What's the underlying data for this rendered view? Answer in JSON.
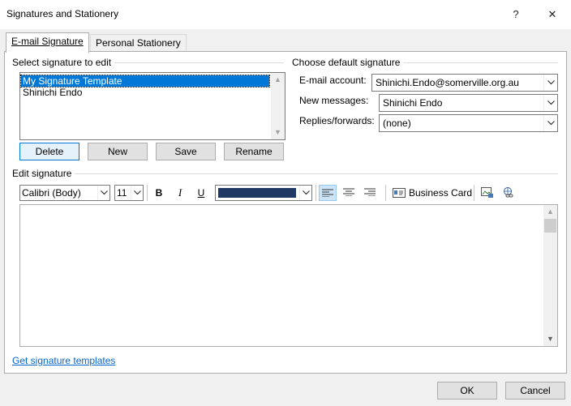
{
  "window": {
    "title": "Signatures and Stationery",
    "help_glyph": "?",
    "close_glyph": "✕"
  },
  "tabs": [
    {
      "label": "E-mail Signature",
      "active": true
    },
    {
      "label": "Personal Stationery",
      "active": false
    }
  ],
  "select_section": {
    "label": "Select signature to edit",
    "items": [
      {
        "label": "My Signature Template",
        "selected": true
      },
      {
        "label": "Shinichi Endo",
        "selected": false
      }
    ],
    "buttons": {
      "delete": "Delete",
      "new": "New",
      "save": "Save",
      "rename": "Rename"
    }
  },
  "default_section": {
    "label": "Choose default signature",
    "email_account": {
      "label": "E-mail account:",
      "value": "Shinichi.Endo@somerville.org.au"
    },
    "new_messages": {
      "label": "New messages:",
      "value": "Shinichi Endo"
    },
    "replies_forwards": {
      "label": "Replies/forwards:",
      "value": "(none)"
    }
  },
  "edit_section": {
    "label": "Edit signature",
    "font": "Calibri (Body)",
    "size": "11",
    "bold": "B",
    "italic": "I",
    "underline": "U",
    "font_color": "#1f3864",
    "business_card": "Business Card"
  },
  "footer": {
    "templates_link": "Get signature templates",
    "ok": "OK",
    "cancel": "Cancel"
  },
  "colors": {
    "accent": "#0078d7",
    "selection_bg": "#0078d7",
    "link": "#0066cc"
  }
}
